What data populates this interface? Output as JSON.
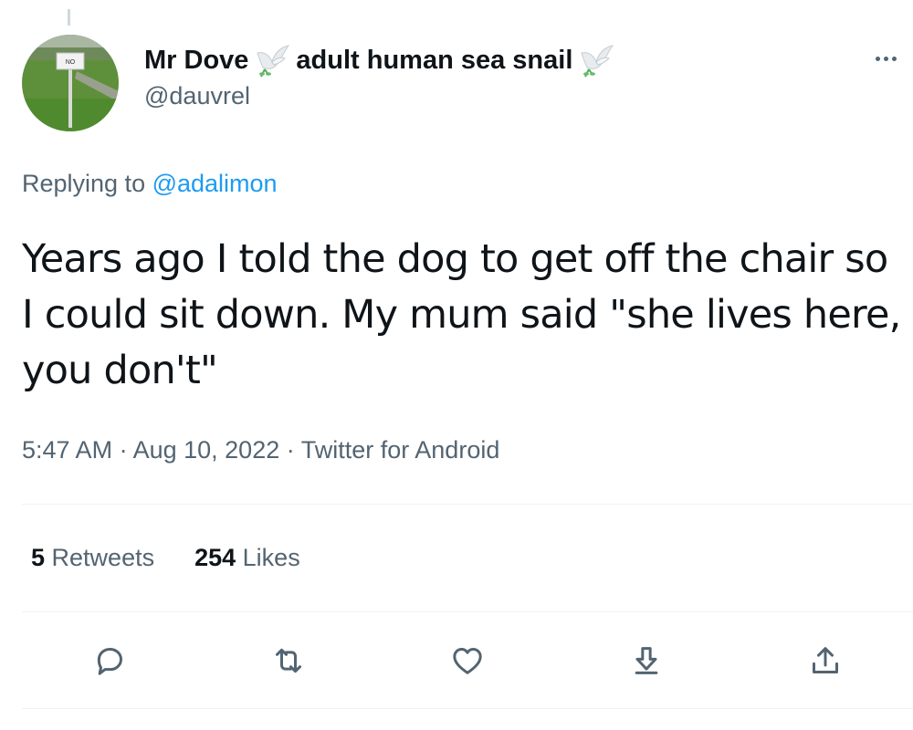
{
  "author": {
    "display_name": "Mr Dove",
    "bio_name": "adult human sea snail",
    "handle": "@dauvrel",
    "avatar_sign_text": "NO"
  },
  "reply": {
    "prefix": "Replying to ",
    "mention": "@adalimon"
  },
  "tweet": {
    "text": "Years ago I told the dog to get off the chair so I could sit down. My mum said \"she lives here, you don't\""
  },
  "meta": {
    "time": "5:47 AM",
    "separator": " · ",
    "date": "Aug 10, 2022",
    "source": "Twitter for Android"
  },
  "stats": {
    "retweets_count": "5",
    "retweets_label": " Retweets",
    "likes_count": "254",
    "likes_label": " Likes"
  },
  "icons": {
    "reply": "speech-bubble-icon",
    "retweet": "retweet-icon",
    "like": "heart-icon",
    "bookmark": "download-icon",
    "share": "share-icon",
    "more": "more-dots-icon",
    "dove": "dove-emoji-icon"
  },
  "colors": {
    "text": "#0f1419",
    "secondary": "#536471",
    "link": "#1d9bf0",
    "divider": "#eff3f4"
  }
}
